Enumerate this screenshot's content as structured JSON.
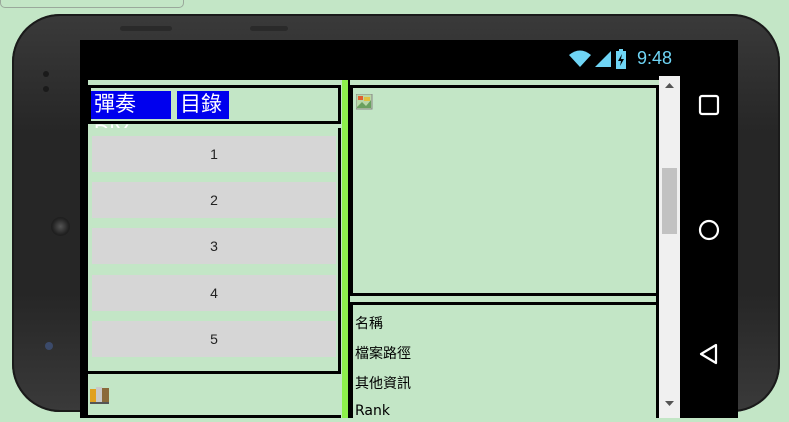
{
  "status_bar": {
    "time": "9:48",
    "icons": [
      "wifi-icon",
      "cell-signal-icon",
      "battery-icon"
    ],
    "color": "#6fd5f5"
  },
  "app": {
    "title_buttons": [
      {
        "label": "彈奏DIY"
      },
      {
        "label": "目錄"
      }
    ],
    "list_buttons": [
      "1",
      "2",
      "3",
      "4",
      "5"
    ],
    "info_labels": [
      "名稱",
      "檔案路徑",
      "其他資訊",
      "Rank"
    ],
    "colors": {
      "background": "#c3e6c6",
      "title_button": "#0000ee",
      "divider": "#8ef04c",
      "list_button": "#d6d6d6"
    }
  },
  "nav": {
    "icons": [
      "recents-square-icon",
      "home-circle-icon",
      "back-triangle-icon"
    ]
  }
}
